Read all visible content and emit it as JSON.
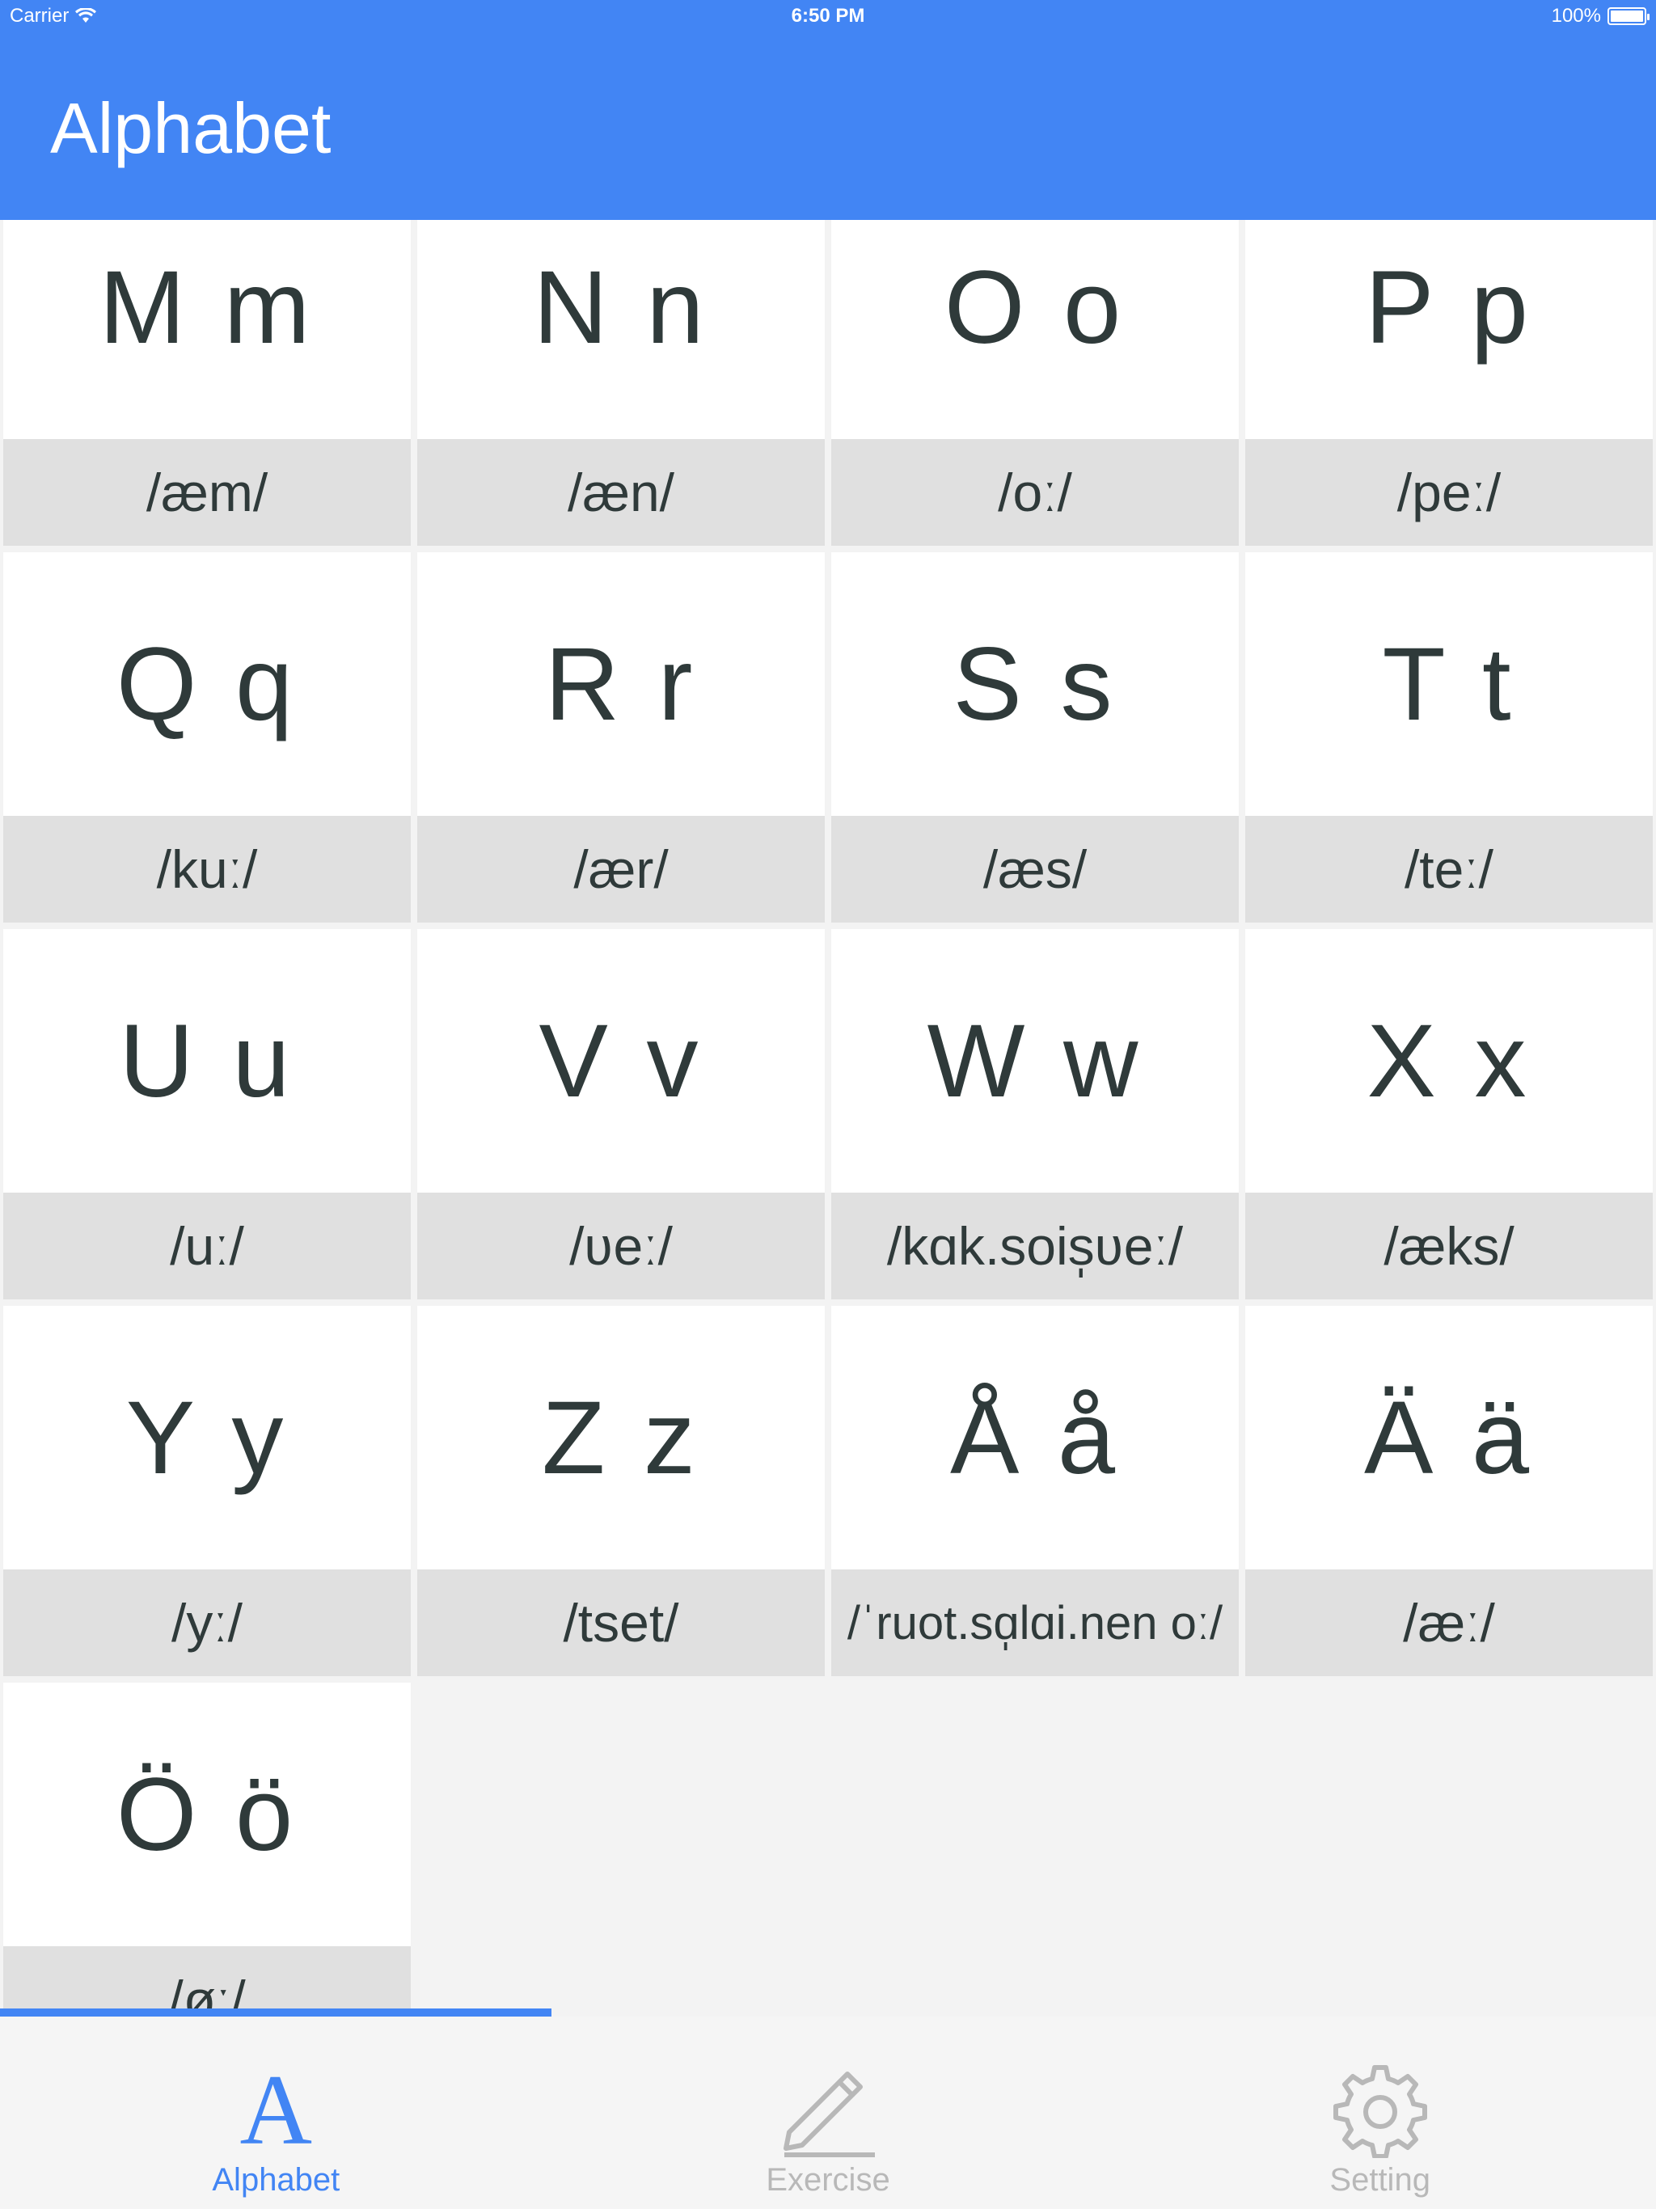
{
  "status": {
    "carrier": "Carrier",
    "time": "6:50 PM",
    "battery": "100%"
  },
  "header": {
    "title": "Alphabet"
  },
  "letters": [
    {
      "letter": "M m",
      "ipa": "/æm/"
    },
    {
      "letter": "N n",
      "ipa": "/æn/"
    },
    {
      "letter": "O o",
      "ipa": "/oː/"
    },
    {
      "letter": "P p",
      "ipa": "/peː/"
    },
    {
      "letter": "Q q",
      "ipa": "/kuː/"
    },
    {
      "letter": "R r",
      "ipa": "/ær/"
    },
    {
      "letter": "S s",
      "ipa": "/æs/"
    },
    {
      "letter": "T t",
      "ipa": "/teː/"
    },
    {
      "letter": "U u",
      "ipa": "/uː/"
    },
    {
      "letter": "V v",
      "ipa": "/ʋeː/"
    },
    {
      "letter": "W w",
      "ipa": "/kɑk.sois̩ʋeː/"
    },
    {
      "letter": "X x",
      "ipa": "/æks/"
    },
    {
      "letter": "Y y",
      "ipa": "/yː/"
    },
    {
      "letter": "Z z",
      "ipa": "/tset/"
    },
    {
      "letter": "Å å",
      "ipa": "/ˈruot.sɑ̩lɑi.nen oː/"
    },
    {
      "letter": "Ä ä",
      "ipa": "/æː/"
    },
    {
      "letter": "Ö ö",
      "ipa": "/øː/"
    }
  ],
  "tabs": [
    {
      "label": "Alphabet",
      "icon": "alphabet-icon",
      "active": true
    },
    {
      "label": "Exercise",
      "icon": "pencil-icon",
      "active": false
    },
    {
      "label": "Setting",
      "icon": "gear-icon",
      "active": false
    }
  ],
  "colors": {
    "accent": "#4285f4",
    "card": "#ffffff",
    "ipa_bg": "#e0e0e0",
    "inactive": "#b8b8b8"
  }
}
